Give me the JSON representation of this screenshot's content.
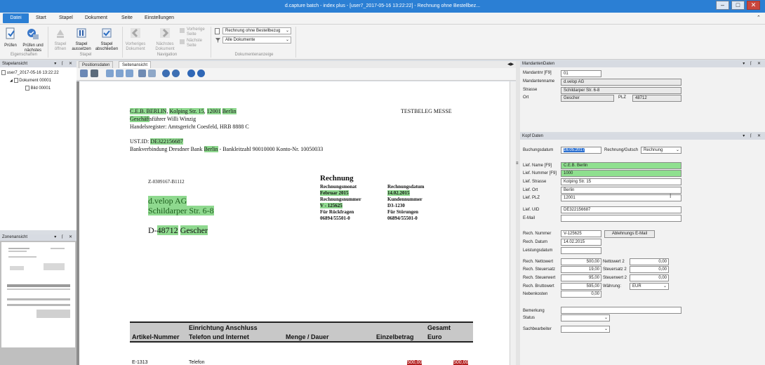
{
  "window": {
    "title": "d.capture batch - index plus - [user7_2017-05-16 13:22:22] - Rechnung ohne Bestellbez..."
  },
  "menu": {
    "items": [
      "Datei",
      "Start",
      "Stapel",
      "Dokument",
      "Seite",
      "Einstellungen"
    ]
  },
  "ribbon": {
    "pruefen": "Prüfen",
    "pruefen_naechstes": [
      "Prüfen und",
      "nächstes"
    ],
    "eigenschaften": "Eigenschaften",
    "stapel_oeffnen": [
      "Stapel",
      "öffnen"
    ],
    "stapel_aussetzen": [
      "Stapel",
      "aussetzen"
    ],
    "stapel_abschliessen": [
      "Stapel",
      "abschließen"
    ],
    "stapel_group": "Stapel",
    "vorheriges_dokument": [
      "Vorheriges",
      "Dokument"
    ],
    "naechstes_dokument": [
      "Nächstes",
      "Dokument"
    ],
    "vorherige_seite": [
      "Vorherige",
      "Seite"
    ],
    "naechste_seite": [
      "Nächste",
      "Seite"
    ],
    "navigation_group": "Navigation",
    "doc_type_select": "Rechnung ohne Bestellbezug",
    "doc_filter_select": "Alle Dokumente",
    "dokumentenanzeige_group": "Dokumentenanzeige"
  },
  "stapelansicht": {
    "title": "Stapelansicht",
    "batch": "user7_2017-05-16 13:22:22",
    "document": "Dokument 00001",
    "image": "Bild 00001"
  },
  "zonenansicht": {
    "title": "Zonenansicht"
  },
  "viewer": {
    "tabs": [
      "Positionsdaten",
      "Seitenansicht"
    ]
  },
  "invoice": {
    "sender": {
      "company": "C.E.B. BERLIN",
      "street": "Kolping Str. 15",
      "zip": "12001",
      "city": "Berlin",
      "ceo_word": "Geschäft",
      "ceo_rest": "sführer Willi Winzig",
      "register": "Handelsregister: Amtsgericht Coesfeld, HRB 8888 C"
    },
    "vat_label": "UST.ID:",
    "vat_id": "DE322156687",
    "bank_pre": "Bankverbindung Dresdner Bank",
    "bank_city": "Berlin",
    "bank_post": "- Bankleitzahl 90010000 Konto-Nr. 10050033",
    "stamp": "TESTBELEG MESSE",
    "ref": "Z-0309167-B1112",
    "recipient": {
      "name": "d.velop AG",
      "street": "Schildarper Str. 6-8",
      "country": "D-",
      "zip": "48712",
      "city": "Gescher"
    },
    "heading": "Rechnung",
    "rechnungsmonat_label": "Rechnungsmonat",
    "rechnungsmonat": "Februar 2015",
    "rechnungsnummer_label": "Rechnungsnummer",
    "rechnungsnummer": "V - 125625",
    "rueckfragen_label": "Für Rückfragen",
    "rueckfragen": "06894/55501-0",
    "rechnungsdatum_label": "Rechnungsdatum",
    "rechnungsdatum": "14.02.2015",
    "kundennummer_label": "Kundennummer",
    "kundennummer": "D3-1230",
    "stoerungen_label": "Für Störungen",
    "stoerungen": "06894/55501-0",
    "table": {
      "h_einrichtung": "Einrichtung Anschluss",
      "h_gesamt": "Gesamt",
      "h_artikel": "Artikel-Nummer",
      "h_telefon": "Telefon und Internet",
      "h_menge": "Menge / Dauer",
      "h_einzel": "Einzelbetrag",
      "h_euro": "Euro",
      "row_art": "E-1313",
      "row_desc": "Telefon",
      "row_einzel": "500,00",
      "row_gesamt": "500,00"
    }
  },
  "mandanten": {
    "title": "MandantenDaten",
    "nr_label": "Mandantnr [F9]",
    "nr": "01",
    "name_label": "Mandantenname",
    "name": "d.velop AG",
    "strasse_label": "Strasse",
    "strasse": "Schildarper Str. 6-8",
    "ort_label": "Ort",
    "ort": "Gescher",
    "plz_label": "PLZ",
    "plz": "48712"
  },
  "kopf": {
    "title": "Kopf Daten",
    "buchungsdatum_label": "Buchungsdatum",
    "buchungsdatum": "16.05.2017",
    "rechnung_gutsch_label": "Rechnung/Gutsch",
    "rechnung_gutsch": "Rechnung",
    "lief_name_label": "Lief. Name [F9]",
    "lief_name": "C.E.B. Berlin",
    "lief_nummer_label": "Lief. Nummer [F9]",
    "lief_nummer": "1000",
    "lief_strasse_label": "Lief. Strasse",
    "lief_strasse": "Kolping Str. 15",
    "lief_ort_label": "Lief. Ort",
    "lief_ort": "Berlin",
    "lief_plz_label": "Lief. PLZ",
    "lief_plz": "12001",
    "lief_uid_label": "Lief. UID",
    "lief_uid": "DE322156687",
    "email_label": "E-Mail",
    "email": "",
    "rech_nummer_label": "Rech. Nummer",
    "rech_nummer": "V-125625",
    "ablehnung_button": "Ablehnungs E-Mail",
    "rech_datum_label": "Rech. Datum",
    "rech_datum": "14.02.2015",
    "leistungsdatum_label": "Leistungsdatum",
    "leistungsdatum": "",
    "nettowert_label": "Rech. Nettowert",
    "nettowert": "500,00",
    "steuersatz_label": "Rech. Steuersatz",
    "steuersatz": "19,00",
    "steuerwert_label": "Rech. Steuerwert",
    "steuerwert": "95,00",
    "bruttowert_label": "Rech. Bruttowert",
    "bruttowert": "595,00",
    "nebenkosten_label": "Nebenkosten",
    "nebenkosten": "0,00",
    "nettowert2_label": "Nettowert 2",
    "nettowert2": "0,00",
    "steuersatz2_label": "Steuersatz 2",
    "steuersatz2": "0,00",
    "steuerwert2_label": "Steuerwert 2",
    "steuerwert2": "0,00",
    "waehrung_label": "Währung:",
    "waehrung": "EUR",
    "bemerkung_label": "Bemerkung",
    "bemerkung": "",
    "status_label": "Status",
    "status": "",
    "sachbearbeiter_label": "Sachbearbeiter",
    "sachbearbeiter": ""
  }
}
